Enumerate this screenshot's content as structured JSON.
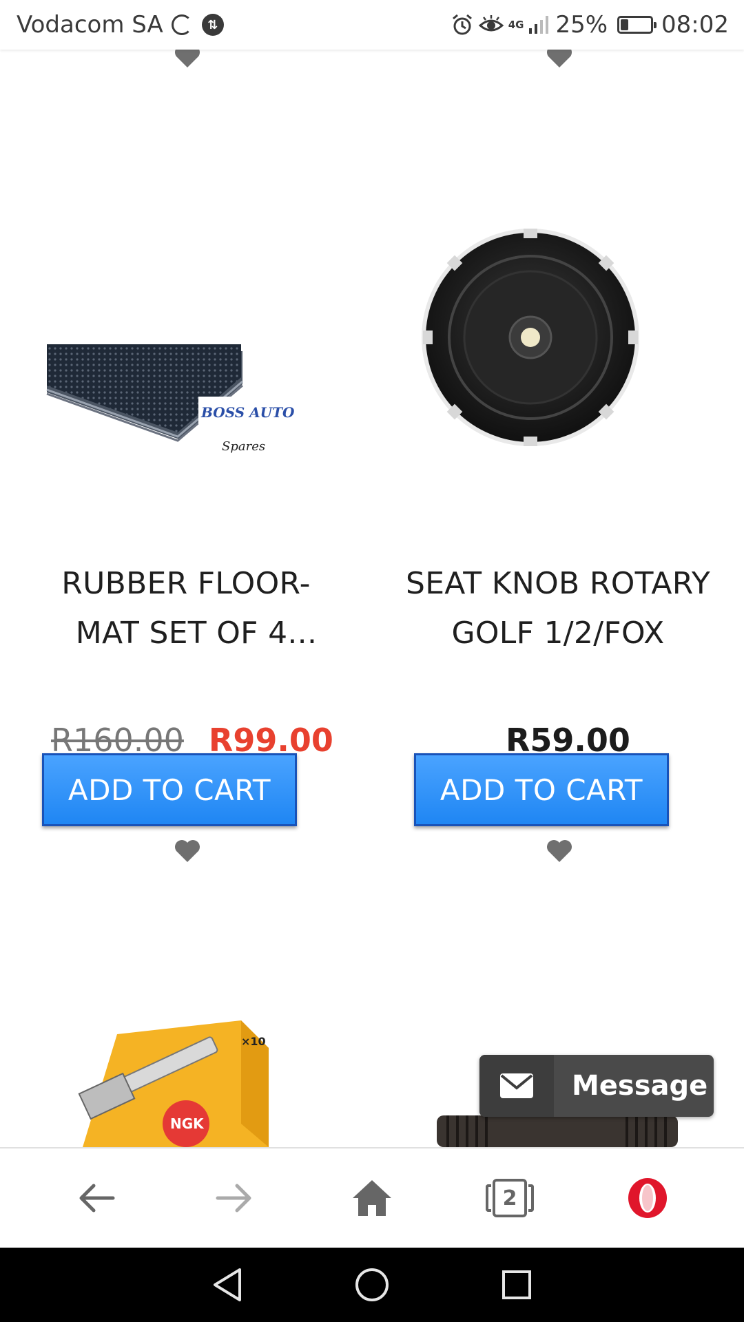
{
  "status_bar": {
    "carrier": "Vodacom SA",
    "data_badge": "⇅",
    "network": "4G",
    "battery_percent": "25%",
    "battery_level": 0.25,
    "time": "08:02"
  },
  "products": [
    {
      "title_line1": "RUBBER FLOOR-",
      "title_line2": "MAT SET OF 4...",
      "price_old": "R160.00",
      "price": "R99.00",
      "on_sale": true,
      "cart_label": "ADD TO CART",
      "image_text": {
        "brand": "BOSS AUTO",
        "sub": "Spares"
      }
    },
    {
      "title_line1": "SEAT KNOB ROTARY",
      "title_line2": "GOLF 1/2/FOX",
      "price": "R59.00",
      "on_sale": false,
      "cart_label": "ADD TO CART"
    },
    {
      "image_text": {
        "brand": "NGK",
        "count": "×10"
      }
    },
    {}
  ],
  "message_widget": {
    "label": "Message"
  },
  "browser_bar": {
    "tab_count": "2",
    "icons": [
      "back-arrow-icon",
      "forward-arrow-icon",
      "home-icon",
      "tabs-icon",
      "opera-logo-icon"
    ]
  },
  "nav_bar": {
    "icons": [
      "back-triangle-icon",
      "home-circle-icon",
      "recents-square-icon"
    ]
  },
  "colors": {
    "button_blue": "#2a8ff7",
    "sale_red": "#e8412f",
    "heart_gray": "#6f6f6f",
    "opera_red": "#e0162b"
  }
}
